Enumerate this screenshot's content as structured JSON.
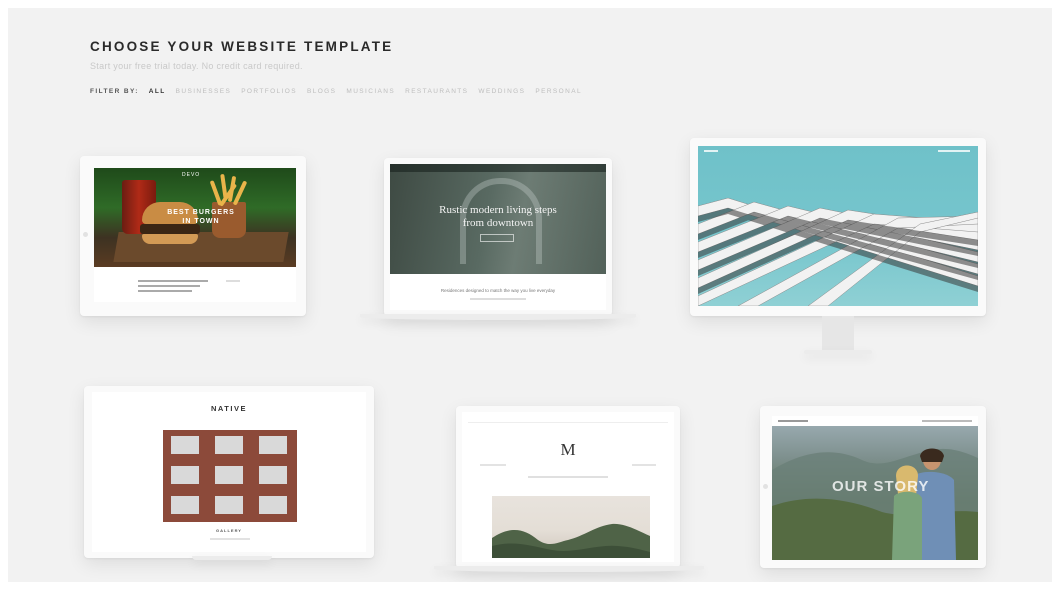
{
  "header": {
    "title": "CHOOSE YOUR WEBSITE TEMPLATE",
    "subtitle": "Start your free trial today. No credit card required."
  },
  "filters": {
    "label": "FILTER BY:",
    "items": [
      "ALL",
      "BUSINESSES",
      "PORTFOLIOS",
      "BLOGS",
      "MUSICIANS",
      "RESTAURANTS",
      "WEDDINGS",
      "PERSONAL"
    ],
    "active": "ALL"
  },
  "templates": [
    {
      "name": "burger",
      "device": "tablet",
      "headline": "BEST BURGERS IN TOWN",
      "logo": "DEVO"
    },
    {
      "name": "rustic",
      "device": "laptop",
      "headline_line1": "Rustic modern living steps",
      "headline_line2": "from downtown",
      "footer_text": "Residences designed to match the way you live everyday"
    },
    {
      "name": "architecture",
      "device": "desktop"
    },
    {
      "name": "native",
      "device": "laptop",
      "title": "NATIVE",
      "caption": "GALLERY"
    },
    {
      "name": "m-journal",
      "device": "laptop",
      "logo": "M"
    },
    {
      "name": "our-story",
      "device": "tablet",
      "headline": "OUR STORY"
    }
  ],
  "colors": {
    "background": "#f2f2f2",
    "title": "#2a2a2a",
    "subtitle": "#c9c9c9",
    "filter_inactive": "#bdbdbd"
  }
}
